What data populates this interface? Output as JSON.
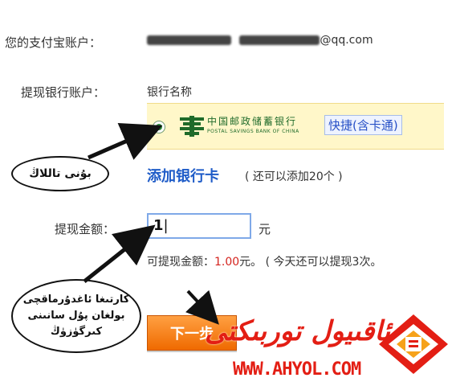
{
  "account": {
    "label": "您的支付宝账户：",
    "email_suffix": "@qq.com"
  },
  "bank": {
    "label": "提现银行账户：",
    "header": "银行名称",
    "name_cn": "中国邮政储蓄银行",
    "name_en": "POSTAL SAVINGS BANK OF CHINA",
    "quick_tag": "快捷(含卡通)"
  },
  "add_card": {
    "link": "添加银行卡",
    "hint": "( 还可以添加20个 )"
  },
  "amount": {
    "label": "提现金额：",
    "value": "1",
    "unit": "元"
  },
  "available": {
    "prefix": "可提现金额：",
    "amount": "1.00",
    "suffix": "元。 ( 今天还可以提现3次。"
  },
  "next_button": "下一步",
  "annotations": {
    "bubble_select_bank": "بۇنى تاللاڭ",
    "bubble_amount": "كارتىغا ئاغدۇرماقچى بولغان پۇل سانىنى كىرگۈزۈڭ"
  },
  "watermark": {
    "name": "ئاقىيول توربىكتى",
    "url": "WWW.AHYOL.COM"
  },
  "colors": {
    "accent_blue": "#1f5cc8",
    "button_orange": "#ef6a00",
    "amount_red": "#d4231e",
    "brand_red": "#e31e14",
    "bank_bg": "#fff7c9"
  }
}
